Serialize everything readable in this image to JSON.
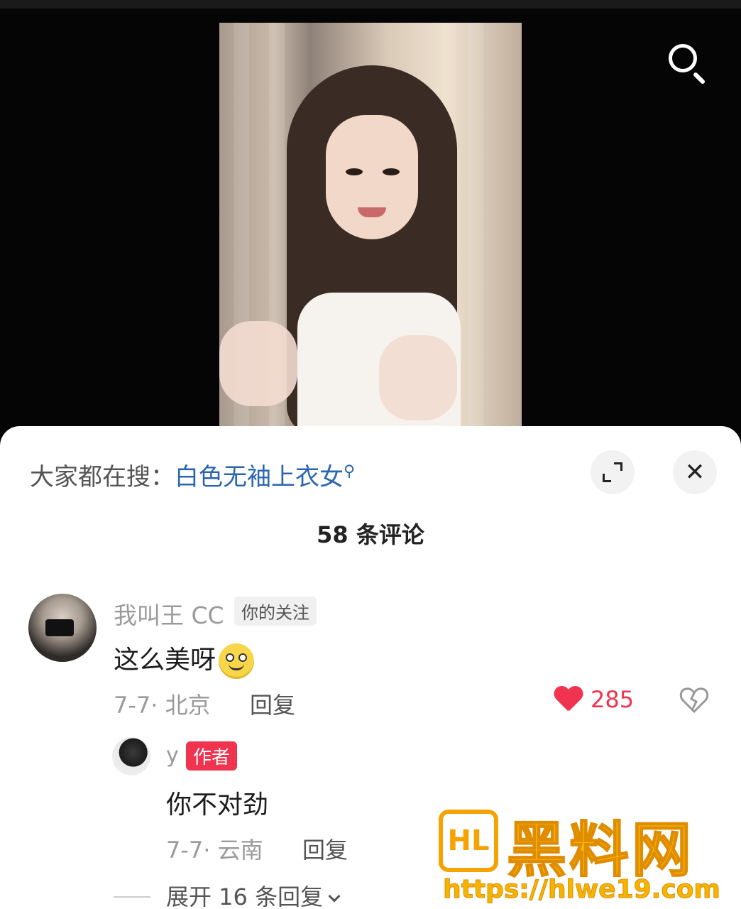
{
  "hot_search": {
    "prefix": "大家都在搜：",
    "term": "白色无袖上衣女",
    "mini_icon": "search-icon"
  },
  "comment_count": "58 条评论",
  "comment": {
    "username": "我叫王 CC",
    "follow_tag": "你的关注",
    "text": "这么美呀",
    "meta": "7-7· 北京",
    "reply_label": "回复",
    "likes": "285"
  },
  "reply": {
    "username": "y",
    "author_tag": "作者",
    "text": "你不对劲",
    "meta": "7-7· 云南",
    "reply_label": "回复"
  },
  "expand_replies": "展开 16 条回复",
  "watermark": {
    "logo": "HL",
    "name": "黑料网",
    "url": "https://hlwe19.com"
  },
  "colors": {
    "like_red": "#f0334f",
    "link_blue": "#2a66b0",
    "watermark_orange": "#f5b400"
  }
}
